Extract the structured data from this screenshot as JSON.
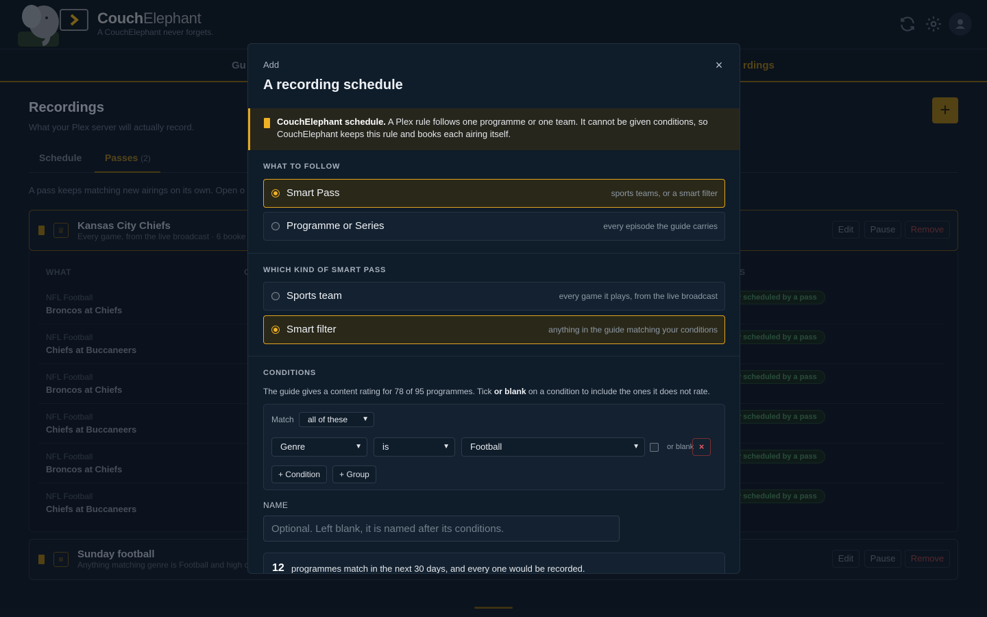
{
  "app": {
    "brand_first": "Couch",
    "brand_second": "Elephant",
    "tagline": "A CouchElephant never forgets."
  },
  "nav": {
    "items": [
      "Gu",
      "rdings"
    ]
  },
  "page": {
    "title": "Recordings",
    "subtitle": "What your Plex server will actually record.",
    "tabs": [
      {
        "label": "Schedule"
      },
      {
        "label": "Passes",
        "count": "(2)"
      }
    ],
    "note": "A pass keeps matching new airings on its own. Open o",
    "add_symbol": "+"
  },
  "passes": [
    {
      "title": "Kansas City Chiefs",
      "subtitle": "Every game, from the live broadcast · 6 booke",
      "edit": "Edit",
      "pause": "Pause",
      "remove": "Remove"
    },
    {
      "title": "Sunday football",
      "subtitle": "Anything matching genre is Football and high c",
      "edit": "Edit",
      "pause": "Pause",
      "remove": "Remove"
    }
  ],
  "recordings_table": {
    "headers": [
      "WHAT",
      "C",
      "S"
    ],
    "rows": [
      {
        "kind": "NFL Football",
        "title": "Broncos at Chiefs",
        "status": "y scheduled by a pass"
      },
      {
        "kind": "NFL Football",
        "title": "Chiefs at Buccaneers",
        "status": "y scheduled by a pass"
      },
      {
        "kind": "NFL Football",
        "title": "Broncos at Chiefs",
        "status": "y scheduled by a pass"
      },
      {
        "kind": "NFL Football",
        "title": "Chiefs at Buccaneers",
        "status": "y scheduled by a pass"
      },
      {
        "kind": "NFL Football",
        "title": "Broncos at Chiefs",
        "status": "y scheduled by a pass"
      },
      {
        "kind": "NFL Football",
        "title": "Chiefs at Buccaneers",
        "status": "y scheduled by a pass"
      }
    ]
  },
  "modal": {
    "eyebrow": "Add",
    "title": "A recording schedule",
    "close": "×",
    "notice": {
      "bold": "CouchElephant schedule.",
      "text": " A Plex rule follows one programme or one team. It cannot be given conditions, so CouchElephant keeps this rule and books each airing itself."
    },
    "follow": {
      "label": "WHAT TO FOLLOW",
      "options": [
        {
          "label": "Smart Pass",
          "hint": "sports teams, or a smart filter",
          "selected": true
        },
        {
          "label": "Programme or Series",
          "hint": "every episode the guide carries",
          "selected": false
        }
      ]
    },
    "kind": {
      "label": "WHICH KIND OF SMART PASS",
      "options": [
        {
          "label": "Sports team",
          "hint": "every game it plays, from the live broadcast",
          "selected": false
        },
        {
          "label": "Smart filter",
          "hint": "anything in the guide matching your conditions",
          "selected": true
        }
      ]
    },
    "conditions": {
      "label": "CONDITIONS",
      "help_pre": "The guide gives a content rating for 78 of 95 programmes. Tick ",
      "help_bold": "or blank",
      "help_post": " on a condition to include the ones it does not rate.",
      "match_label": "Match",
      "match_value": "all of these",
      "field": "Genre",
      "operator": "is",
      "value": "Football",
      "or_blank_label": "or blank",
      "remove": "×",
      "add_condition": "+ Condition",
      "add_group": "+ Group"
    },
    "name": {
      "label": "NAME",
      "placeholder": "Optional. Left blank, it is named after its conditions."
    },
    "summary": {
      "count": "12",
      "text": "programmes match in the next 30 days, and every one would be recorded."
    }
  },
  "colors": {
    "accent": "#f0b125",
    "background": "#0f1a27",
    "modal_bg": "#0f1c2a",
    "danger": "#e05a63",
    "success": "#3d7152"
  }
}
